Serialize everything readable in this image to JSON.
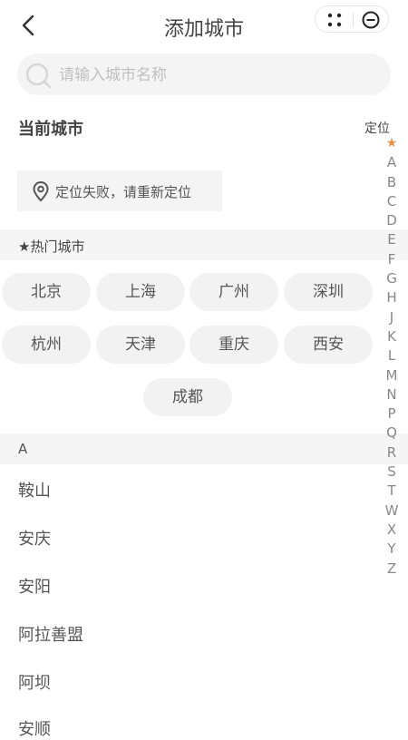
{
  "header": {
    "title": "添加城市"
  },
  "search": {
    "placeholder": "请输入城市名称",
    "value": ""
  },
  "current_city": {
    "heading": "当前城市",
    "locate_label": "定位",
    "status": "定位失败，请重新定位"
  },
  "hot": {
    "heading": "★热门城市",
    "cities": [
      "北京",
      "上海",
      "广州",
      "深圳",
      "杭州",
      "天津",
      "重庆",
      "西安",
      "成都"
    ]
  },
  "section_a": {
    "letter": "A",
    "cities": [
      "鞍山",
      "安庆",
      "安阳",
      "阿拉善盟",
      "阿坝",
      "安顺"
    ]
  },
  "index": [
    "★",
    "A",
    "B",
    "C",
    "D",
    "E",
    "F",
    "G",
    "H",
    "J",
    "K",
    "L",
    "M",
    "N",
    "P",
    "Q",
    "R",
    "S",
    "T",
    "W",
    "X",
    "Y",
    "Z"
  ],
  "colors": {
    "accent": "#e8904a",
    "chip_bg": "#f2f2f2",
    "bar_bg": "#f5f5f5"
  }
}
